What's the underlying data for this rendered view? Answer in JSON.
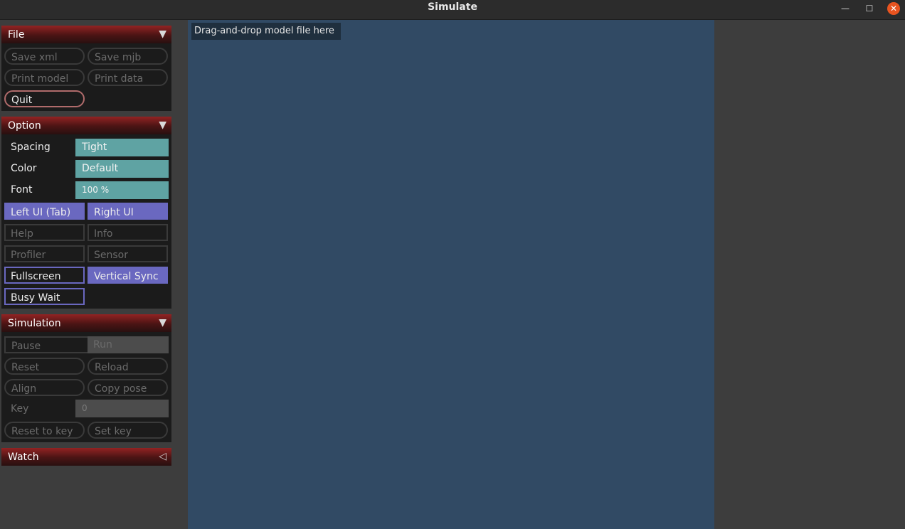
{
  "window": {
    "title": "Simulate",
    "minimize_glyph": "—",
    "maximize_glyph": "☐",
    "close_glyph": "✕"
  },
  "file": {
    "title": "File",
    "arrow": "▼",
    "save_xml": "Save xml",
    "save_mjb": "Save mjb",
    "print_model": "Print model",
    "print_data": "Print data",
    "quit": "Quit"
  },
  "option": {
    "title": "Option",
    "arrow": "▼",
    "spacing_label": "Spacing",
    "spacing_value": "Tight",
    "color_label": "Color",
    "color_value": "Default",
    "font_label": "Font",
    "font_value": "100 %",
    "left_ui": "Left UI (Tab)",
    "right_ui": "Right UI",
    "help": "Help",
    "info": "Info",
    "profiler": "Profiler",
    "sensor": "Sensor",
    "fullscreen": "Fullscreen",
    "vertical_sync": "Vertical Sync",
    "busy_wait": "Busy Wait"
  },
  "simulation": {
    "title": "Simulation",
    "arrow": "▼",
    "pause": "Pause",
    "run": "Run",
    "reset": "Reset",
    "reload": "Reload",
    "align": "Align",
    "copy_pose": "Copy pose",
    "key_label": "Key",
    "key_value": "0",
    "reset_to_key": "Reset to key",
    "set_key": "Set key"
  },
  "watch": {
    "title": "Watch",
    "arrow": "◁"
  },
  "viewport": {
    "message": "Drag-and-drop model file here"
  }
}
